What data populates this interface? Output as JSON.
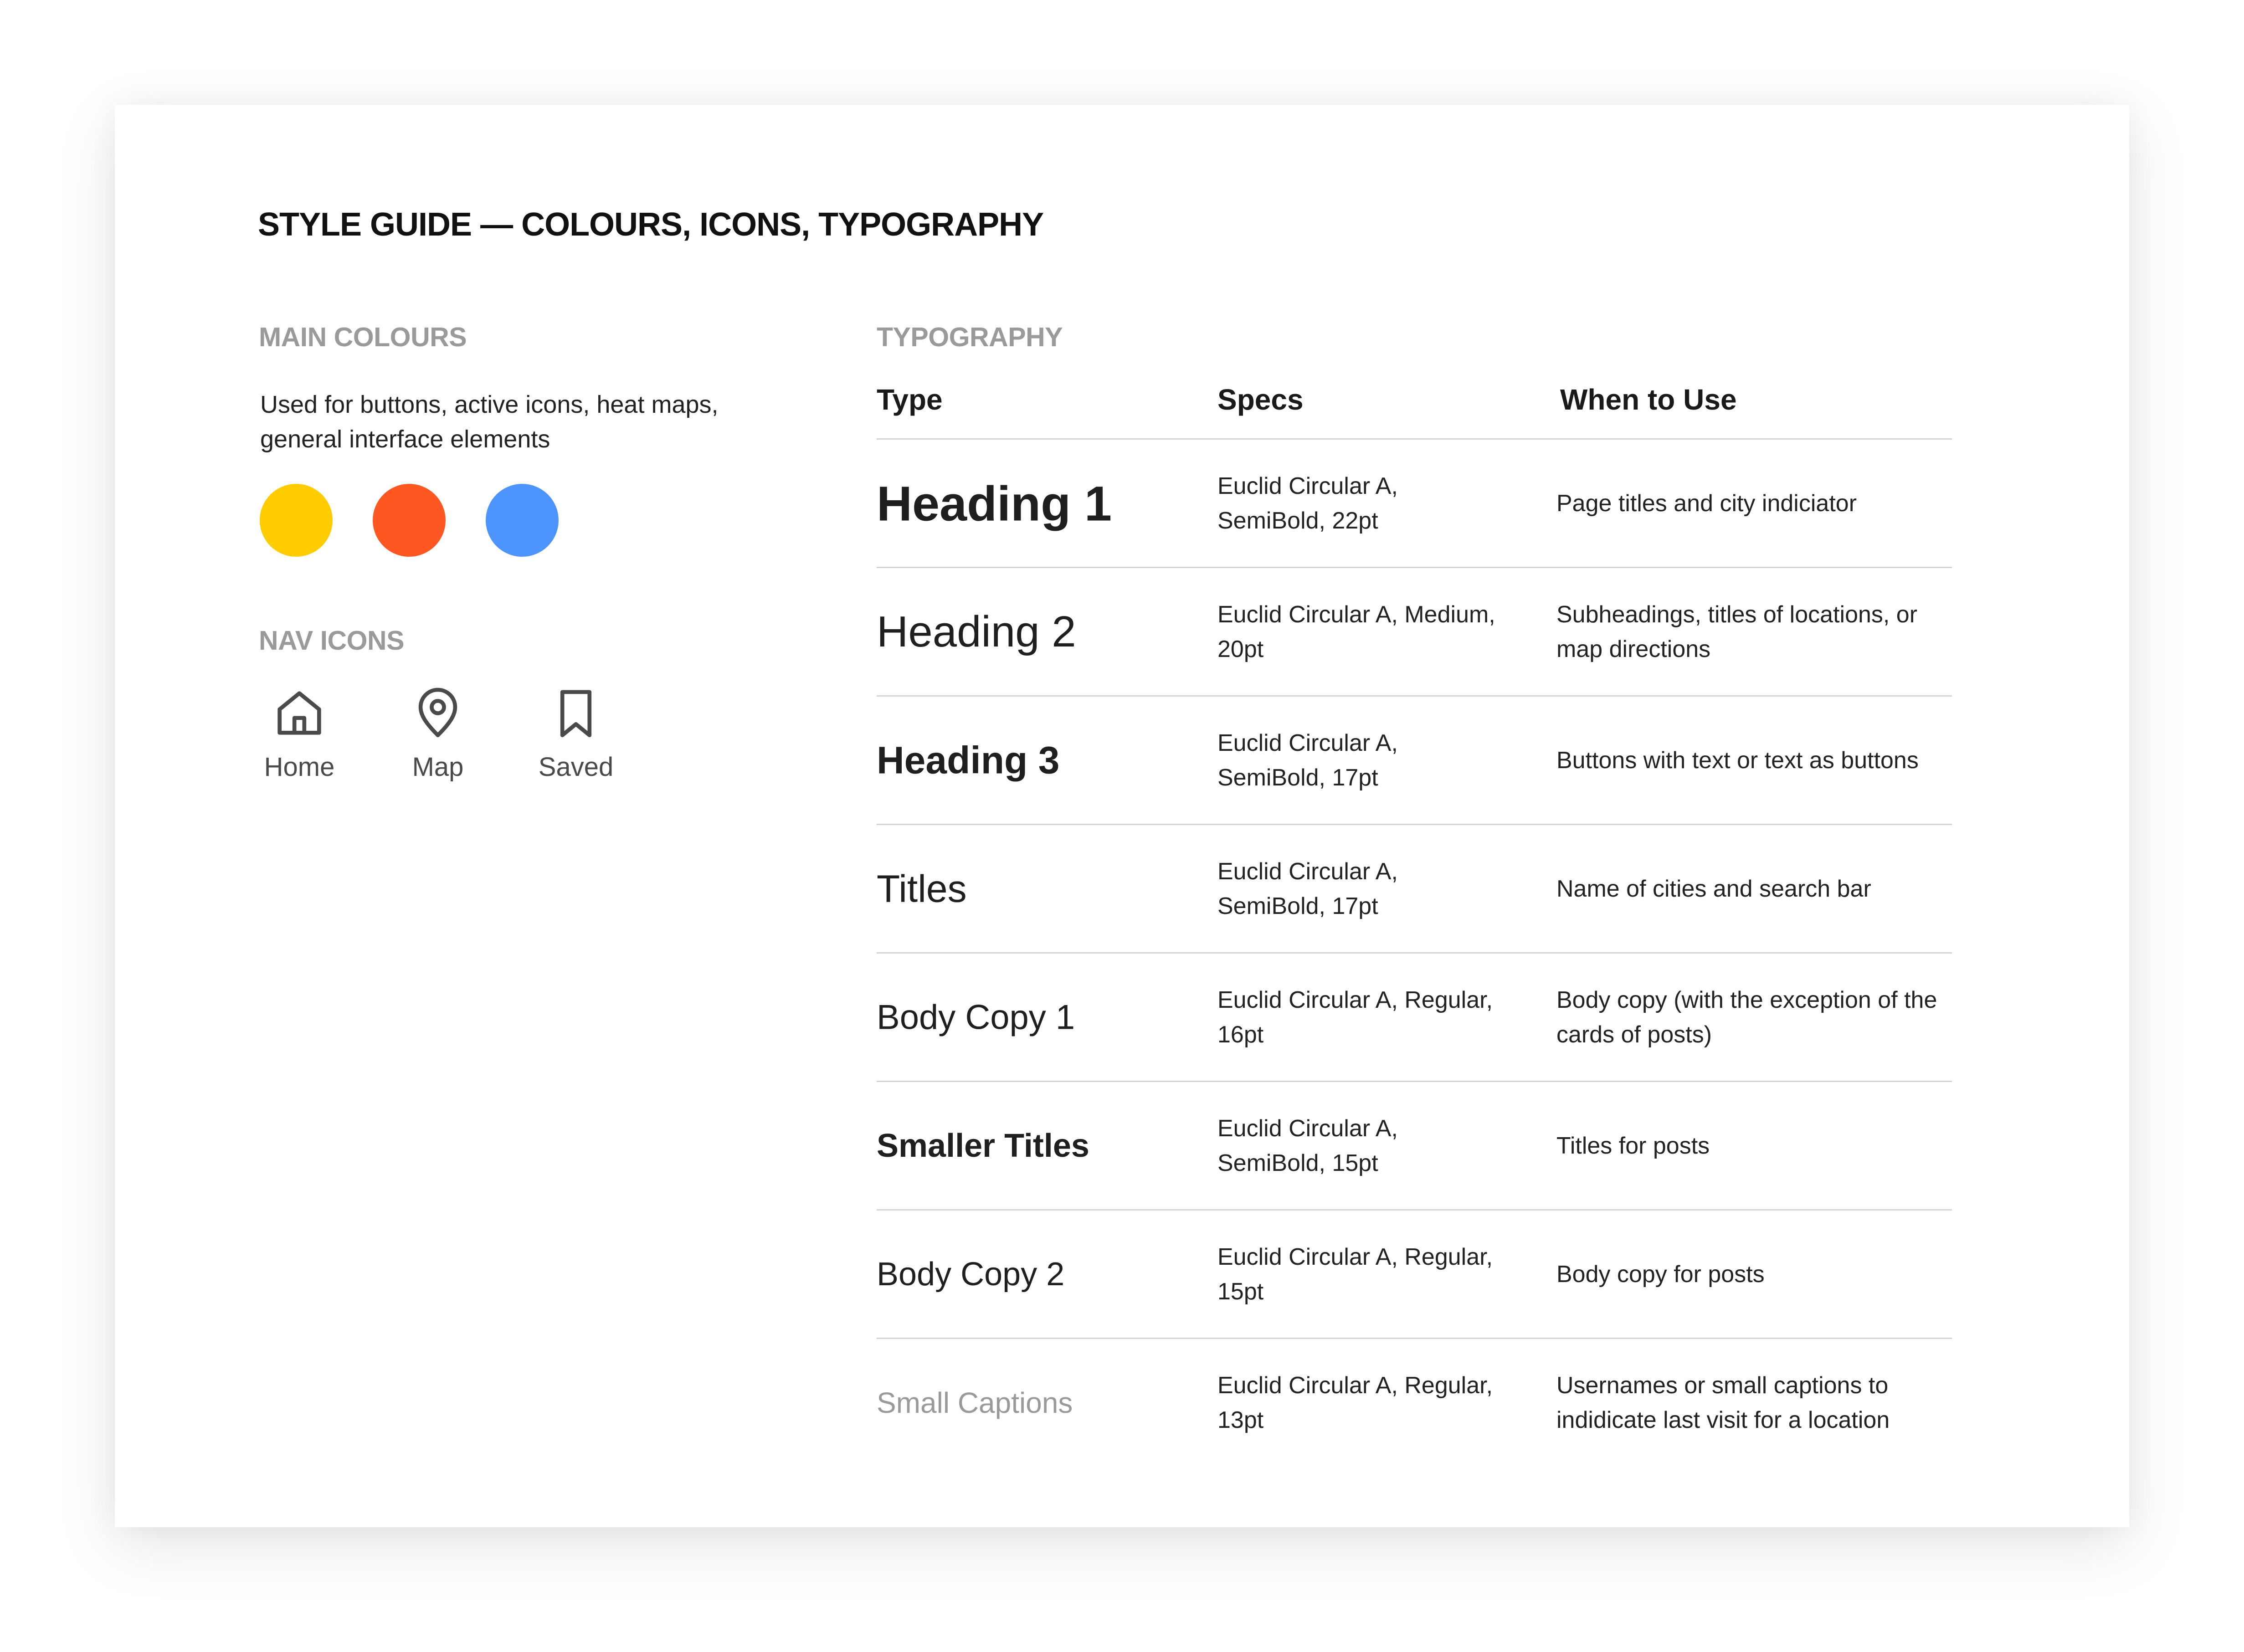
{
  "title": "STYLE GUIDE — COLOURS, ICONS, TYPOGRAPHY",
  "colours": {
    "label": "MAIN COLOURS",
    "description": "Used for buttons, active icons, heat maps, general interface elements",
    "swatches": [
      "#FFCC00",
      "#FF5722",
      "#4D94FF"
    ]
  },
  "nav_icons": {
    "label": "NAV ICONS",
    "items": [
      {
        "icon": "home-icon",
        "label": "Home"
      },
      {
        "icon": "map-pin-icon",
        "label": "Map"
      },
      {
        "icon": "bookmark-icon",
        "label": "Saved"
      }
    ]
  },
  "typography": {
    "label": "TYPOGRAPHY",
    "headers": {
      "type": "Type",
      "specs": "Specs",
      "use": "When to Use"
    },
    "rows": [
      {
        "type": "Heading 1",
        "specs": "Euclid Circular A, SemiBold, 22pt",
        "use": "Page titles and city indiciator"
      },
      {
        "type": "Heading 2",
        "specs": "Euclid Circular A, Medium, 20pt",
        "use": "Subheadings, titles of locations, or map directions"
      },
      {
        "type": "Heading 3",
        "specs": "Euclid Circular A, SemiBold, 17pt",
        "use": "Buttons with text or text as buttons"
      },
      {
        "type": "Titles",
        "specs": "Euclid Circular A, SemiBold, 17pt",
        "use": "Name of cities and search bar"
      },
      {
        "type": "Body Copy 1",
        "specs": "Euclid Circular A, Regular, 16pt",
        "use": "Body copy (with the exception of the cards of posts)"
      },
      {
        "type": "Smaller Titles",
        "specs": "Euclid Circular A, SemiBold, 15pt",
        "use": "Titles for posts"
      },
      {
        "type": "Body Copy 2",
        "specs": "Euclid Circular A, Regular, 15pt",
        "use": "Body copy for posts"
      },
      {
        "type": "Small Captions",
        "specs": "Euclid Circular A, Regular, 13pt",
        "use": "Usernames or small captions to indidicate last visit for a location"
      }
    ]
  }
}
